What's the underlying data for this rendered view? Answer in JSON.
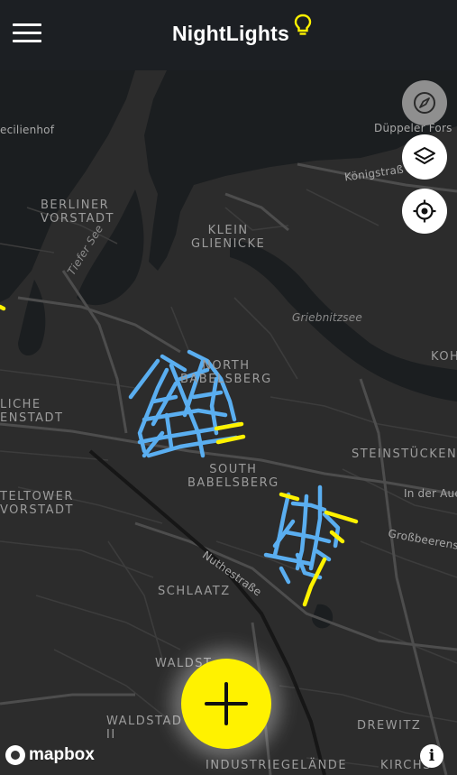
{
  "header": {
    "title": "NightLights",
    "menu_icon": "hamburger-menu-icon",
    "title_icon": "lightbulb-icon",
    "accent_color": "#fff200"
  },
  "map": {
    "labels": {
      "cecilienhof": "ecilienhof",
      "dueppeler": "Düppeler Fors",
      "koenigstrasse": "Königstraß",
      "berliner_vorstadt": "BERLINER\nVORSTADT",
      "klein_glienicke": "KLEIN\nGLIENICKE",
      "tiefer_see": "Tiefer See",
      "griebnitzsee": "Griebnitzsee",
      "north_babelsberg": "NORTH\nBABELSBERG",
      "koh": "KOH",
      "liche_enstadt": "LICHE\nENSTADT",
      "south_babelsberg": "SOUTH\nBABELSBERG",
      "steinstuecken": "STEINSTÜCKEN",
      "teltower_vorstadt": "TELTOWER\nVORSTADT",
      "in_der_aue": "In der Aue",
      "grossbeerenstr": "Großbeerens",
      "nuthestrasse": "Nuthestraße",
      "schlaatz": "SCHLAATZ",
      "waldstadt_i": "WALDST",
      "waldstadt_ii": "WALDSTAD\nII",
      "drewitz": "DREWITZ",
      "industriegelaende": "INDUSTRIEGELÄNDE",
      "kirchsteigfeld": "KIRCHS"
    },
    "road_color": "#4a4a4a",
    "water_color": "#1a1d1f",
    "route_color_lit": "#5aaef0",
    "route_color_highlight": "#fff200"
  },
  "controls": {
    "compass_icon": "compass-icon",
    "layers_icon": "layers-icon",
    "locate_icon": "location-target-icon"
  },
  "fab": {
    "icon": "plus-icon"
  },
  "attribution": {
    "logo_text": "mapbox",
    "info_label": "i"
  }
}
